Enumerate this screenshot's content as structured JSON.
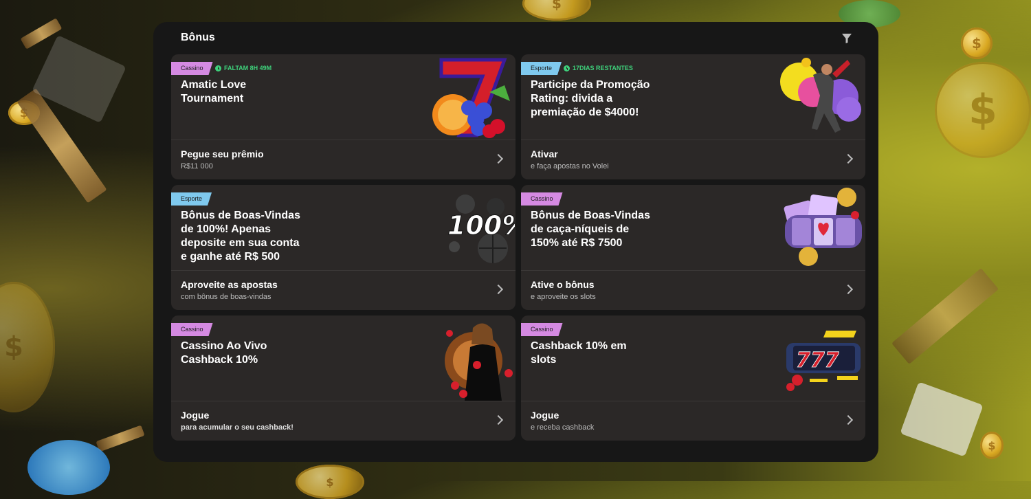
{
  "panel": {
    "title": "Bônus"
  },
  "icons": {
    "filter": "filter-icon",
    "clock": "clock-icon",
    "chevron": "chevron-right-icon"
  },
  "colors": {
    "panel_bg": "#171717",
    "card_bg": "#2b2827",
    "tag_cassino": "#d58ae2",
    "tag_esporte": "#7fc9ee",
    "timer_green": "#3ed17b"
  },
  "cards": [
    {
      "tag": "Cassino",
      "timer": "FALTAM 8H 49M",
      "title": "Amatic Love Tournament",
      "cta": "Pegue seu prêmio",
      "cta_sub": "R$11 000",
      "art": "slot-seven-fruits"
    },
    {
      "tag": "Esporte",
      "timer": "17DIAS RESTANTES",
      "title": "Participe da Promoção Rating: divida a premiação de $4000!",
      "cta": "Ativar",
      "cta_sub": "e faça apostas no Volei",
      "art": "volleyball-player"
    },
    {
      "tag": "Esporte",
      "title": "Bônus de Boas-Vindas de 100%! Apenas deposite em sua conta e ganhe até R$ 500",
      "cta": "Aproveite as apostas",
      "cta_sub": "com bônus de boas-vindas",
      "art_text": "100%",
      "art": "sports-balls"
    },
    {
      "tag": "Cassino",
      "title": "Bônus de Boas-Vindas de caça-níqueis de 150% até R$ 7500",
      "cta": "Ative o bônus",
      "cta_sub": "e aproveite os slots",
      "art": "slot-reels-cards"
    },
    {
      "tag": "Cassino",
      "title": "Cassino Ao Vivo Cashback 10%",
      "cta": "Jogue",
      "cta_sub": "para acumular o seu cashback!",
      "art": "live-dealer-roulette"
    },
    {
      "tag": "Cassino",
      "title": "Cashback 10% em slots",
      "cta": "Jogue",
      "cta_sub": "e receba cashback",
      "art_text": "777",
      "art": "slot-machine-777"
    }
  ]
}
